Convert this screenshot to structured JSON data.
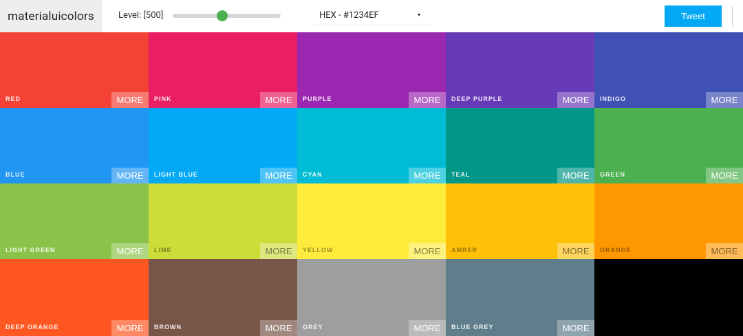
{
  "header": {
    "brand": "materialuicolors",
    "level_label": "Level: [500]",
    "level_value": 500,
    "format_value": "HEX - #1234EF",
    "format_caret": "▾",
    "tweet_label": "Tweet"
  },
  "more_label": "MORE",
  "colors": [
    {
      "name": "RED",
      "hex": "#F44336"
    },
    {
      "name": "PINK",
      "hex": "#E91E63"
    },
    {
      "name": "PURPLE",
      "hex": "#9C27B0"
    },
    {
      "name": "DEEP PURPLE",
      "hex": "#673AB7"
    },
    {
      "name": "INDIGO",
      "hex": "#3F51B5"
    },
    {
      "name": "BLUE",
      "hex": "#2196F3"
    },
    {
      "name": "LIGHT BLUE",
      "hex": "#03A9F4"
    },
    {
      "name": "CYAN",
      "hex": "#00BCD4"
    },
    {
      "name": "TEAL",
      "hex": "#009688"
    },
    {
      "name": "GREEN",
      "hex": "#4CAF50"
    },
    {
      "name": "LIGHT GREEN",
      "hex": "#8BC34A"
    },
    {
      "name": "LIME",
      "hex": "#CDDC39"
    },
    {
      "name": "YELLOW",
      "hex": "#FFEB3B"
    },
    {
      "name": "AMBER",
      "hex": "#FFC107"
    },
    {
      "name": "ORANGE",
      "hex": "#FF9800"
    },
    {
      "name": "DEEP ORANGE",
      "hex": "#FF5722"
    },
    {
      "name": "BROWN",
      "hex": "#795548"
    },
    {
      "name": "GREY",
      "hex": "#9E9E9E"
    },
    {
      "name": "BLUE GREY",
      "hex": "#607D8B"
    },
    {
      "name": "",
      "hex": "#000000"
    }
  ]
}
